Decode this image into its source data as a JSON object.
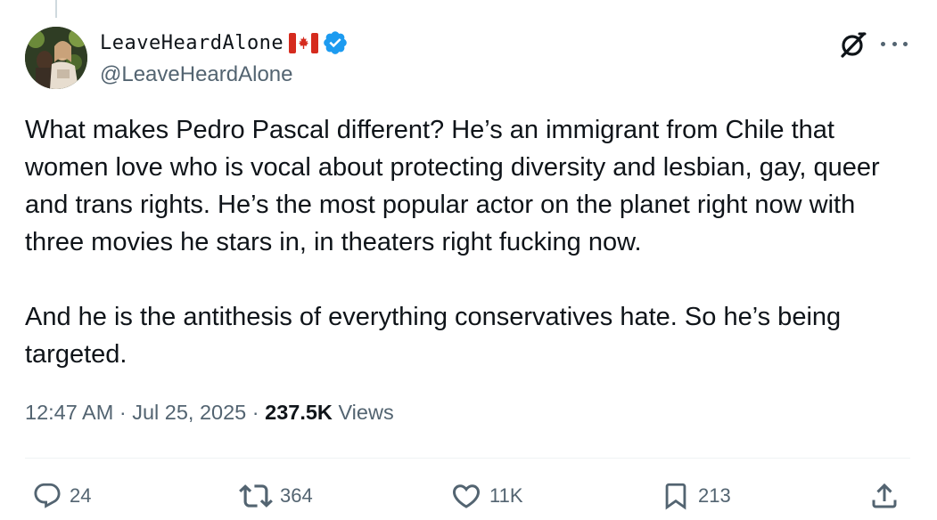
{
  "author": {
    "display_name": "LeaveHeardAlone",
    "handle": "@LeaveHeardAlone",
    "flag": "canada-flag",
    "verified": true,
    "verified_color": "#1d9bf0"
  },
  "tweet": {
    "paragraphs": [
      "What makes Pedro Pascal different? He’s an immigrant from Chile that women love who is vocal about protecting diversity and lesbian, gay, queer and trans rights. He’s the most popular actor on the planet right now with three movies he stars in, in theaters right fucking now.",
      "And he is the antithesis of everything conservatives hate. So he’s being targeted."
    ]
  },
  "meta": {
    "time": "12:47 AM",
    "separator": "·",
    "date": "Jul 25, 2025",
    "views_count": "237.5K",
    "views_label": "Views"
  },
  "actions": {
    "replies": "24",
    "reposts": "364",
    "likes": "11K",
    "bookmarks": "213"
  },
  "icons": {
    "header": [
      "grok-icon",
      "more-icon"
    ],
    "actions": [
      "reply-icon",
      "repost-icon",
      "like-icon",
      "bookmark-icon",
      "share-icon"
    ]
  },
  "colors": {
    "text_primary": "#0f1419",
    "text_secondary": "#536471",
    "divider": "#eff3f4",
    "canada_red": "#d52b1e"
  }
}
